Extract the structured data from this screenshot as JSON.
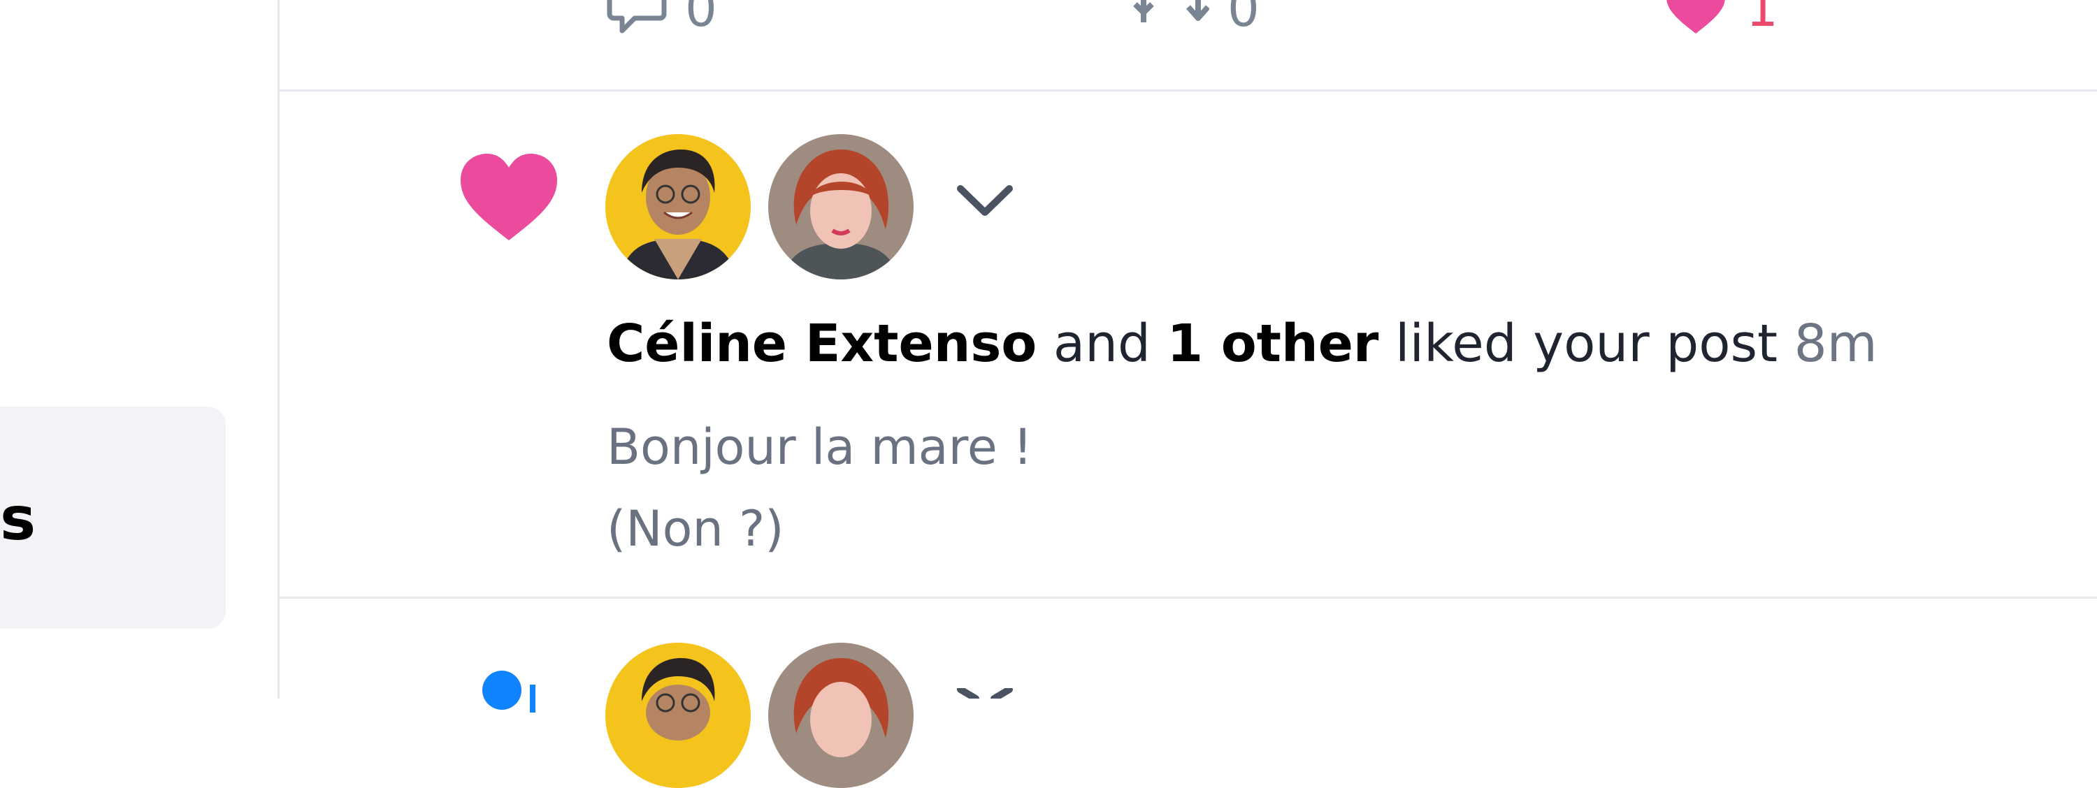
{
  "sidebar": {
    "nav_label": "s"
  },
  "previous_post": {
    "reply_count": "0",
    "repost_count": "0",
    "like_count": "1"
  },
  "notification": {
    "actor": "Céline Extenso",
    "connector": "and",
    "others": "1 other",
    "action": "liked your post",
    "time": "8m",
    "post_line1": "Bonjour la mare !",
    "post_line2": "(Non ?)"
  },
  "colors": {
    "like_pink": "#ec4a9c",
    "like_count": "#ec4a6c",
    "muted": "#7a8594",
    "follow_blue": "#1083fe",
    "avatar_yellow": "#f4c31c"
  },
  "icons": {
    "reply": "reply-icon",
    "repost": "repost-icon",
    "like": "heart-icon",
    "notification_type": "heart-icon",
    "expand": "chevron-down-icon",
    "next_type": "person-add-icon"
  }
}
